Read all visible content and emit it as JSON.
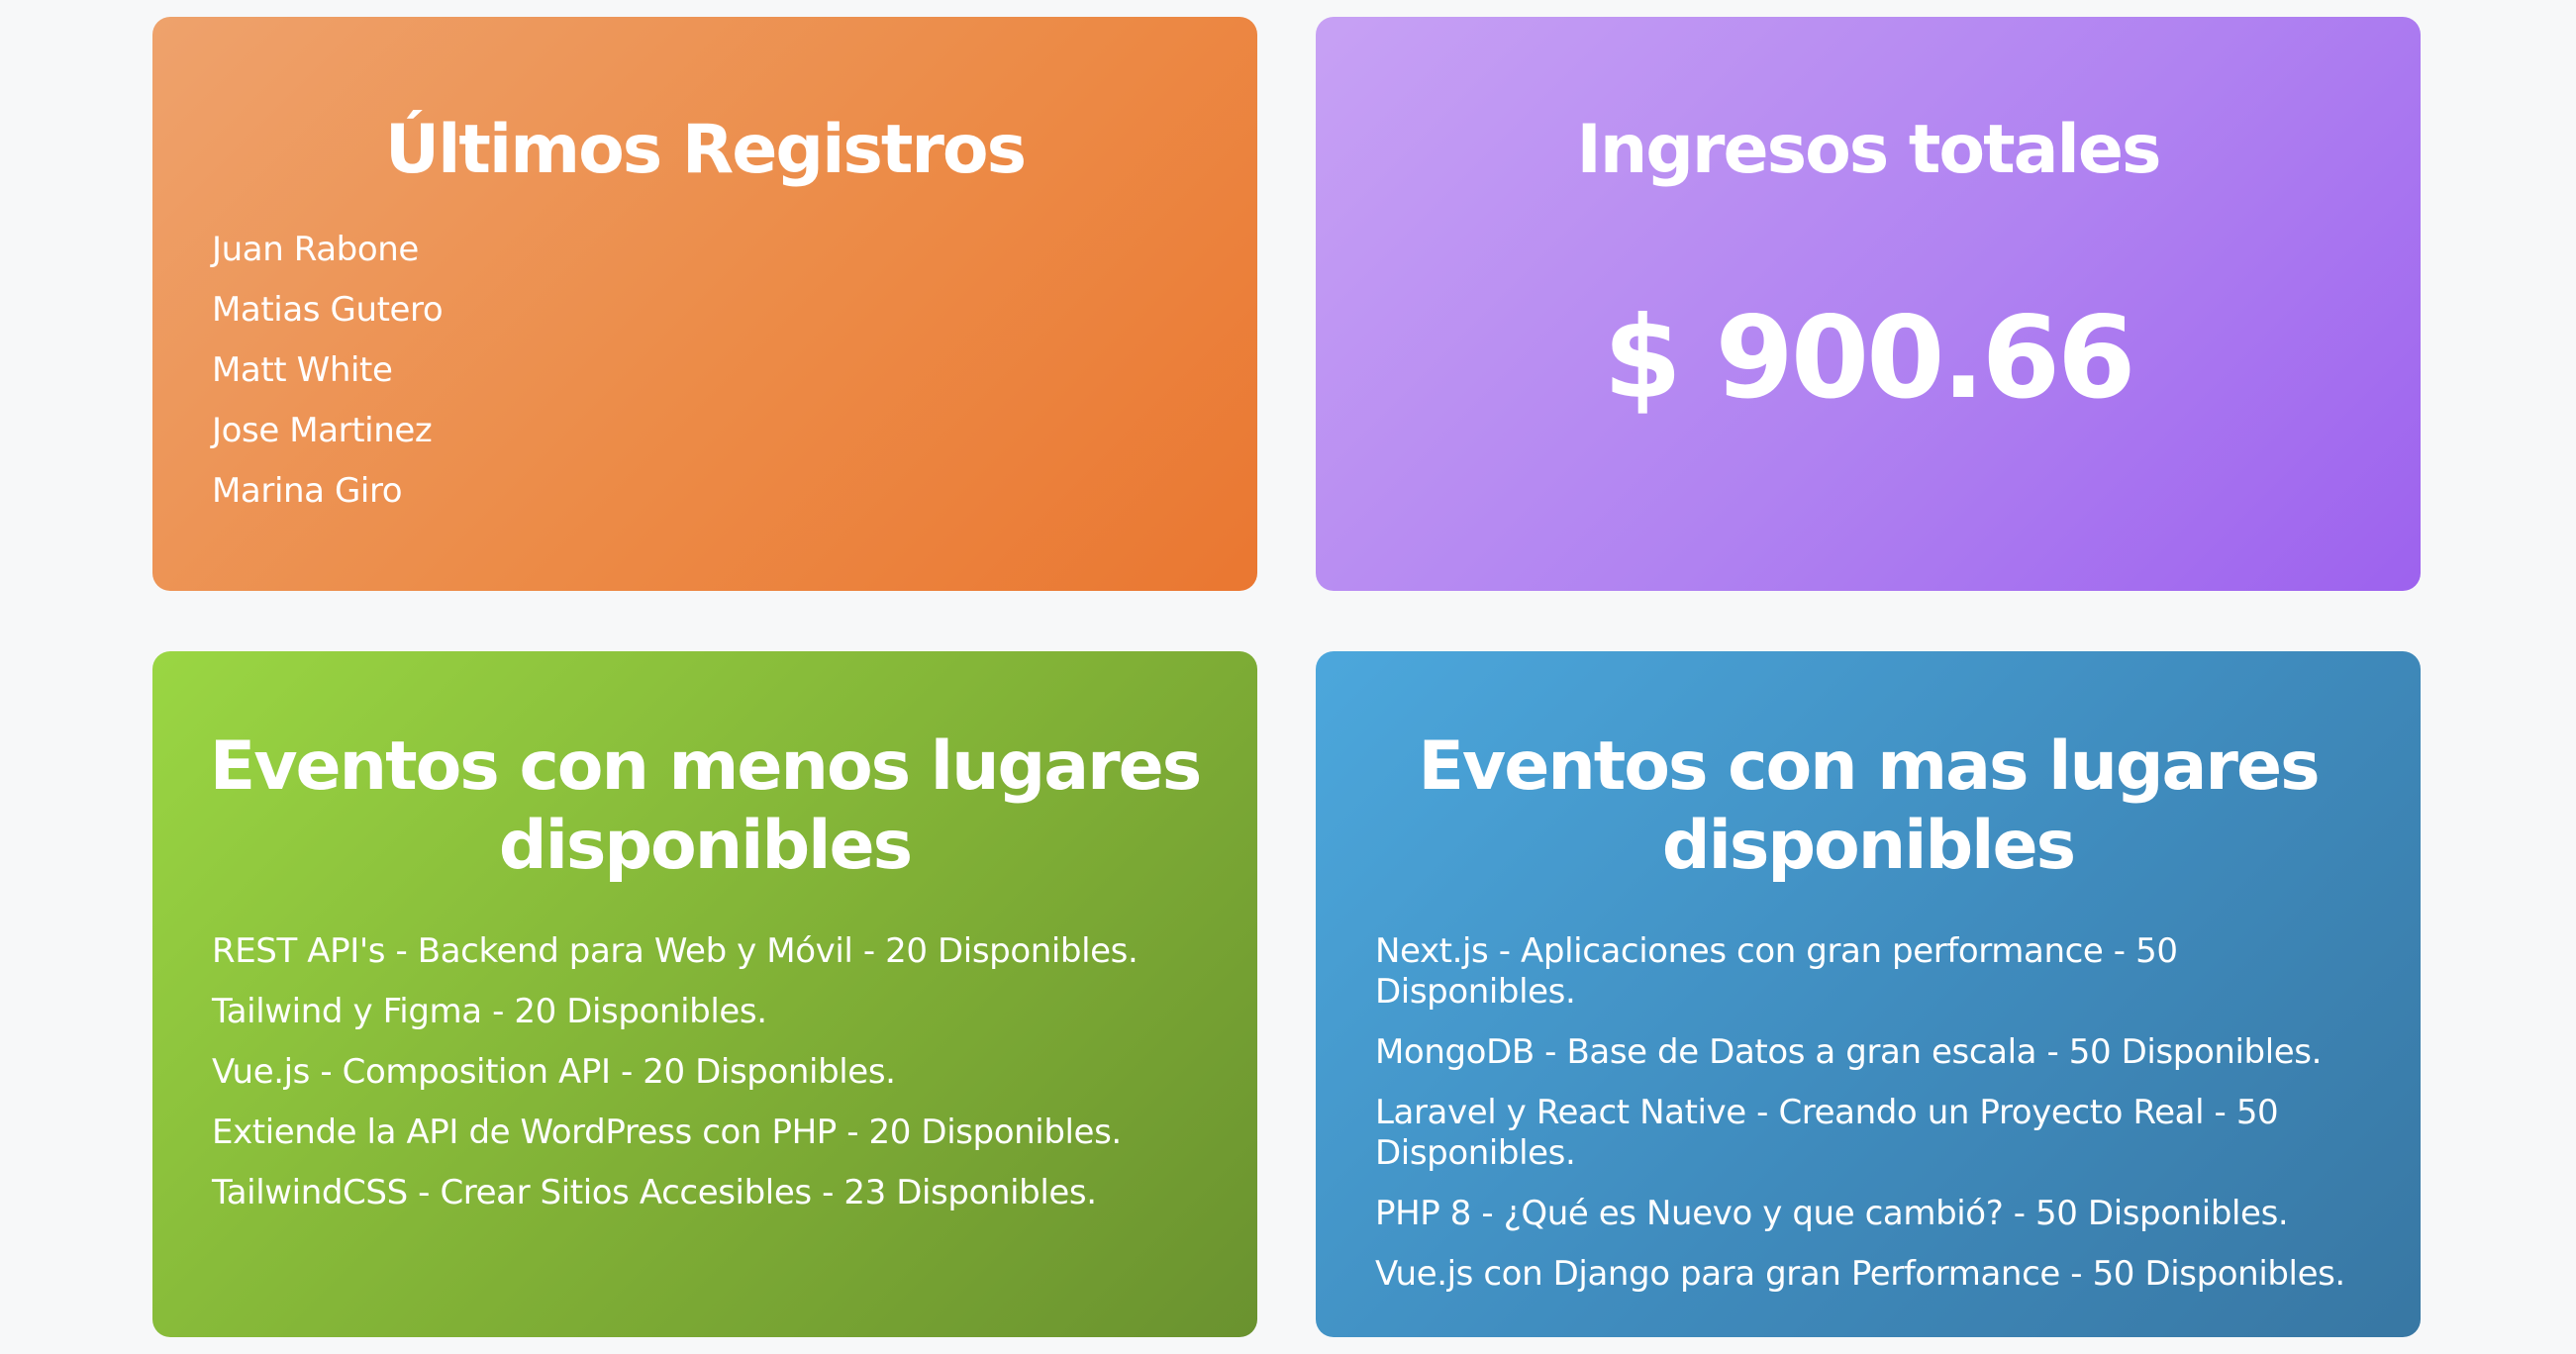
{
  "colors": {
    "page_background": "#f7f8f9",
    "registros_card": "#ec8b47",
    "ingresos_card": "#b082f1",
    "menos_card": "#80b036",
    "mas_card": "#3f8bbd",
    "text": "#ffffff"
  },
  "registros": {
    "title": "Últimos Registros",
    "items": [
      "Juan Rabone",
      "Matias Gutero",
      "Matt White",
      "Jose Martinez",
      "Marina Giro"
    ]
  },
  "ingresos": {
    "title": "Ingresos totales",
    "amount": "$ 900.66"
  },
  "menos_lugares": {
    "title_line1": "Eventos con menos lugares",
    "title_line2": "disponibles",
    "items": [
      "REST API's - Backend para Web y Móvil - 20 Disponibles.",
      "Tailwind y Figma - 20 Disponibles.",
      "Vue.js - Composition API - 20 Disponibles.",
      "Extiende la API de WordPress con PHP - 20 Disponibles.",
      "TailwindCSS - Crear Sitios Accesibles - 23 Disponibles."
    ]
  },
  "mas_lugares": {
    "title_line1": "Eventos con mas lugares",
    "title_line2": "disponibles",
    "items": [
      "Next.js - Aplicaciones con gran performance - 50 Disponibles.",
      "MongoDB - Base de Datos a gran escala - 50 Disponibles.",
      "Laravel y React Native - Creando un Proyecto Real - 50 Disponibles.",
      "PHP 8 - ¿Qué es Nuevo y que cambió? - 50 Disponibles.",
      "Vue.js con Django para gran Performance - 50 Disponibles."
    ]
  }
}
